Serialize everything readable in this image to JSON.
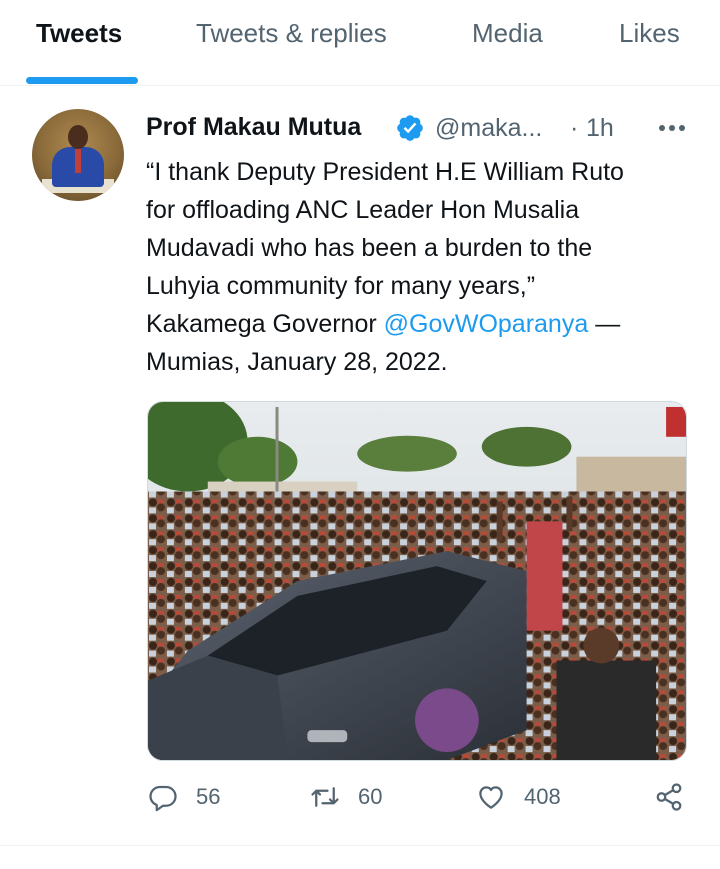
{
  "tabs": [
    {
      "label": "Tweets",
      "active": true
    },
    {
      "label": "Tweets & replies",
      "active": false
    },
    {
      "label": "Media",
      "active": false
    },
    {
      "label": "Likes",
      "active": false
    }
  ],
  "tweet": {
    "display_name": "Prof Makau Mutua",
    "verified_icon": "verified-badge-icon",
    "handle": "@maka...",
    "separator": "·",
    "time": "1h",
    "text_lines": [
      "“I thank Deputy President H.E William Ruto",
      "for offloading ANC Leader Hon Musalia",
      "Mudavadi who has been a burden to the",
      "Luhyia community for many years,”"
    ],
    "text_line5_prefix": "Kakamega Governor ",
    "mention": "@GovWOparanya",
    "text_line5_suffix": " —",
    "text_line6": "Mumias, January 28, 2022.",
    "stats": {
      "replies": "56",
      "retweets": "60",
      "likes": "408"
    }
  },
  "colors": {
    "accent": "#1d9bf0",
    "text_primary": "#0f1419",
    "text_secondary": "#536471",
    "divider": "#eff3f4"
  }
}
